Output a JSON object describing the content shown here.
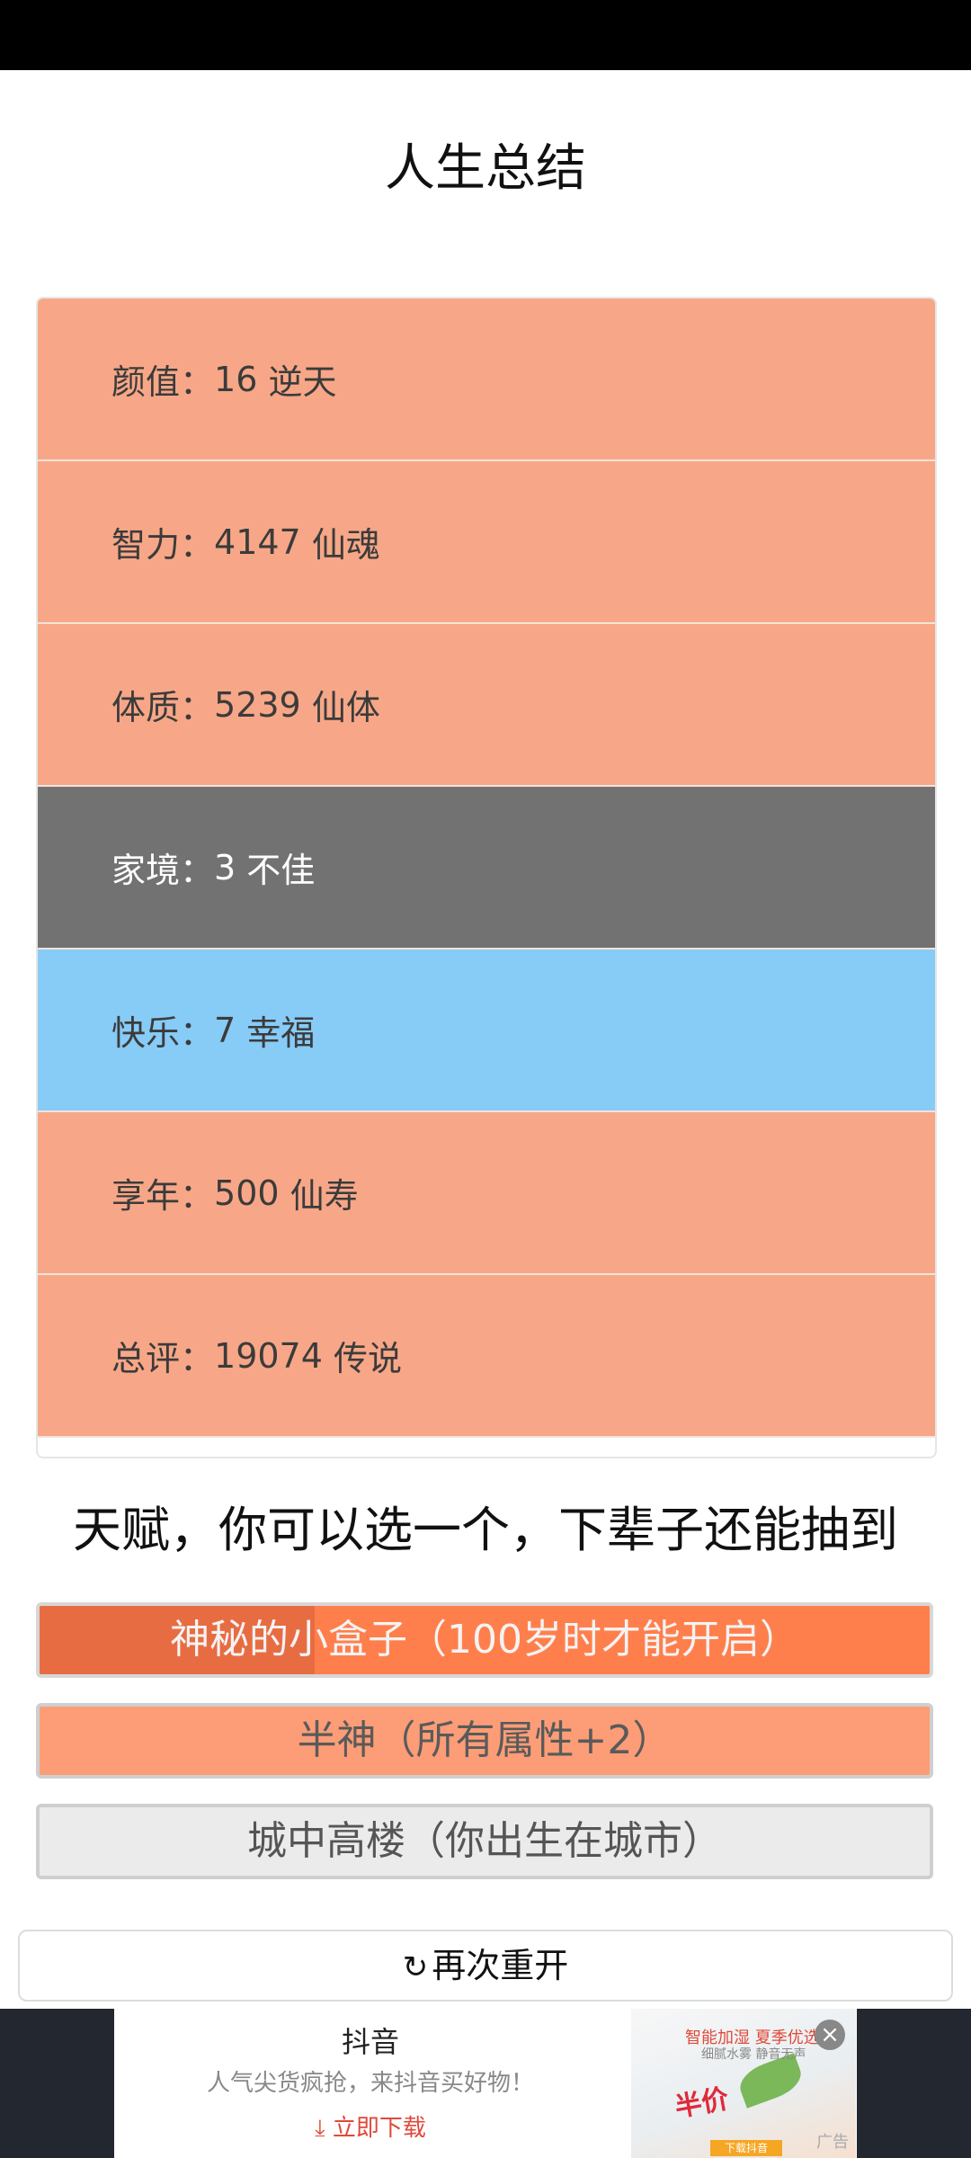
{
  "page": {
    "title": "人生总结"
  },
  "stats": [
    {
      "label": "颜值：",
      "value": "16",
      "rank": "逆天",
      "color": "orange"
    },
    {
      "label": "智力：",
      "value": "4147",
      "rank": "仙魂",
      "color": "orange"
    },
    {
      "label": "体质：",
      "value": "5239",
      "rank": "仙体",
      "color": "orange"
    },
    {
      "label": "家境：",
      "value": "3",
      "rank": "不佳",
      "color": "gray"
    },
    {
      "label": "快乐：",
      "value": "7",
      "rank": "幸福",
      "color": "blue"
    },
    {
      "label": "享年：",
      "value": "500",
      "rank": "仙寿",
      "color": "orange"
    },
    {
      "label": "总评：",
      "value": "19074",
      "rank": "传说",
      "color": "orange"
    }
  ],
  "talents": {
    "heading": "天赋，你可以选一个，下辈子还能抽到",
    "items": [
      {
        "label": "神秘的小盒子（100岁时才能开启）"
      },
      {
        "label": "半神（所有属性+2）"
      },
      {
        "label": "城中高楼（你出生在城市）"
      }
    ]
  },
  "restart": {
    "icon": "refresh-icon",
    "label": "再次重开"
  },
  "ad": {
    "title": "抖音",
    "description": "人气尖货疯抢，来抖音买好物！",
    "cta": "立即下载",
    "image_headline": "智能加湿 夏季优选",
    "image_subtitle": "细腻水雾 静音无声",
    "image_big_text": "半价",
    "image_button": "下载抖音",
    "label": "广告",
    "close_icon": "close-icon"
  },
  "colors": {
    "orange": "#f7a787",
    "gray": "#727272",
    "blue": "#87cbf7",
    "selected_talent": "#ff7f4c"
  }
}
